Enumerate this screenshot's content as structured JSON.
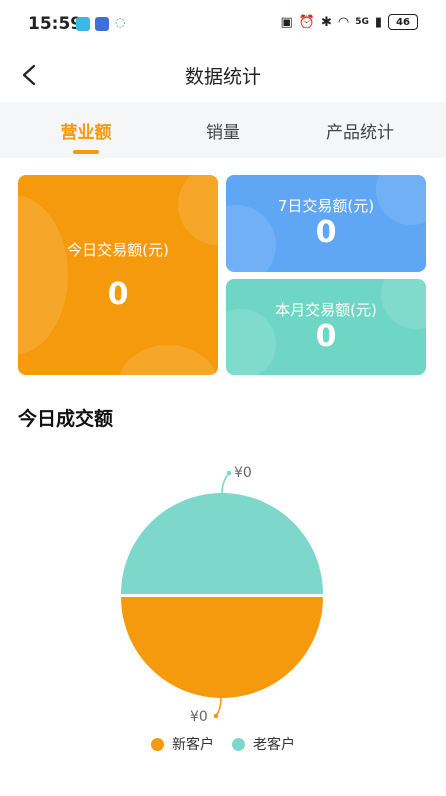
{
  "status": {
    "time": "15:59",
    "battery": "46",
    "network": "5G"
  },
  "nav": {
    "title": "数据统计"
  },
  "tabs": [
    {
      "label": "营业额",
      "active": true
    },
    {
      "label": "销量",
      "active": false
    },
    {
      "label": "产品统计",
      "active": false
    }
  ],
  "cards": {
    "today": {
      "label": "今日交易额(元)",
      "value": "0"
    },
    "week": {
      "label": "7日交易额(元)",
      "value": "0"
    },
    "month": {
      "label": "本月交易额(元)",
      "value": "0"
    }
  },
  "section": {
    "title": "今日成交额"
  },
  "colors": {
    "accent": "#f59a0c",
    "blue": "#5fa6f5",
    "teal": "#6fd6c5",
    "old_customer": "#7dd8cb",
    "new_customer": "#f59a0c"
  },
  "chart_data": {
    "type": "pie",
    "categories": [
      "新客户",
      "老客户"
    ],
    "values": [
      0,
      0
    ],
    "labels": [
      "¥0",
      "¥0"
    ],
    "legend": "bottom"
  }
}
